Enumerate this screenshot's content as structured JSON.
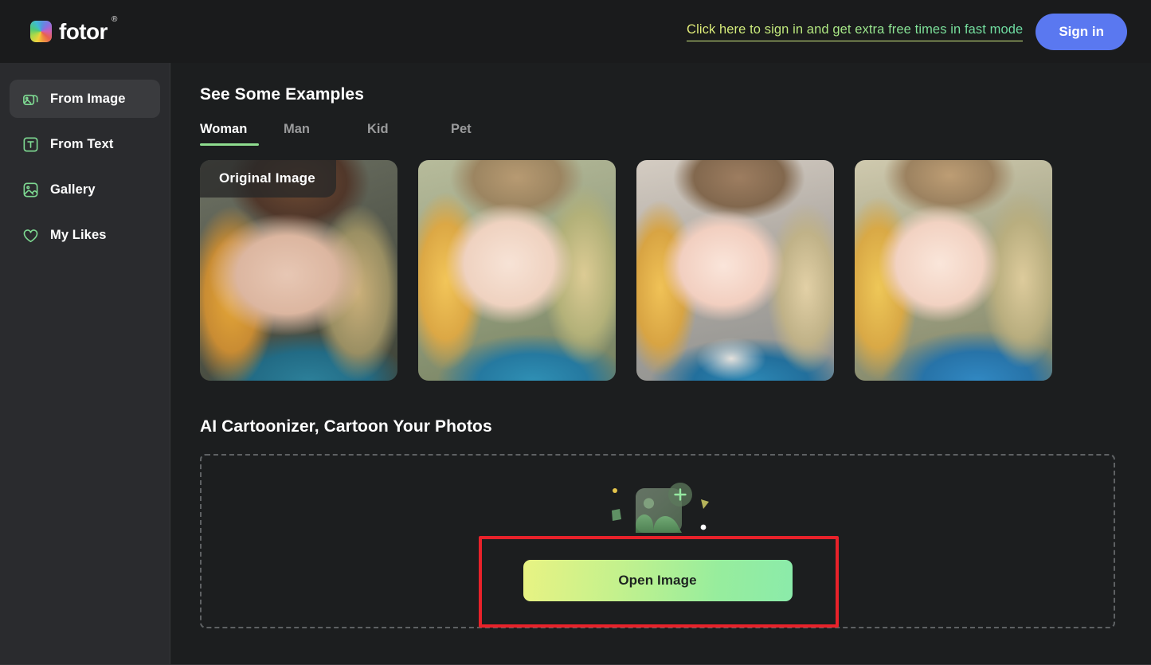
{
  "header": {
    "brand_name": "fotor",
    "brand_registered": "®",
    "brand_icon": "fotor-logo-icon",
    "promo_link": "Click here to sign in and get extra free times in fast mode",
    "signin_label": "Sign in",
    "signin_color": "#5a78f0",
    "promo_gradient_start": "#e7f07a",
    "promo_gradient_end": "#6ddfa5"
  },
  "sidebar": {
    "items": [
      {
        "label": "From Image",
        "icon": "stacked-images-icon",
        "active": true
      },
      {
        "label": "From Text",
        "icon": "text-box-icon",
        "active": false
      },
      {
        "label": "Gallery",
        "icon": "gallery-image-icon",
        "active": false
      },
      {
        "label": "My Likes",
        "icon": "heart-icon",
        "active": false
      }
    ],
    "icon_color": "#7ed992"
  },
  "examples": {
    "title": "See Some Examples",
    "tabs": [
      {
        "label": "Woman",
        "active": true
      },
      {
        "label": "Man",
        "active": false
      },
      {
        "label": "Kid",
        "active": false
      },
      {
        "label": "Pet",
        "active": false
      }
    ],
    "tab_underline_color": "#8fdd8f",
    "cards": [
      {
        "name": "original-photo",
        "badge": "Original Image",
        "style": "photo-orig"
      },
      {
        "name": "cartoon-result-1",
        "badge": "",
        "style": "photo-c1"
      },
      {
        "name": "cartoon-result-2",
        "badge": "",
        "style": "photo-c2"
      },
      {
        "name": "cartoon-result-3",
        "badge": "",
        "style": "photo-c3"
      }
    ]
  },
  "uploader": {
    "title": "AI Cartoonizer, Cartoon Your Photos",
    "upload_icon": "add-image-icon",
    "open_button_label": "Open Image",
    "open_button_gradient_start": "#e8f383",
    "open_button_gradient_end": "#8bebaa",
    "highlight_color": "#e8222a"
  }
}
